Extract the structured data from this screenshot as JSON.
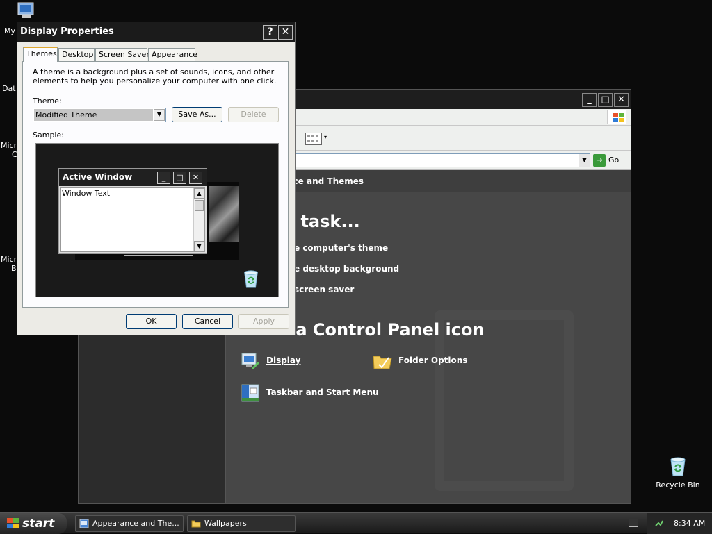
{
  "desktop": {
    "icons": [
      {
        "label": "My"
      },
      {
        "label": "Dat"
      },
      {
        "label": "Micro"
      },
      {
        "label": "C"
      },
      {
        "label": "Micr"
      },
      {
        "label": "B"
      }
    ],
    "recycle_bin": "Recycle Bin"
  },
  "control_panel": {
    "go_label": "Go",
    "header": "nce and Themes",
    "pick_task": "n task...",
    "tasks": [
      "e computer's theme",
      "e desktop background",
      "screen saver"
    ],
    "pick_icon": "k a Control Panel icon",
    "icons": [
      {
        "label": "Display"
      },
      {
        "label": "Folder Options"
      },
      {
        "label": "Taskbar and Start Menu"
      }
    ]
  },
  "dialog": {
    "title": "Display Properties",
    "help": "?",
    "close": "✕",
    "tabs": [
      "Themes",
      "Desktop",
      "Screen Saver",
      "Appearance"
    ],
    "description": "A theme is a background plus a set of sounds, icons, and other elements to help you personalize your computer with one click.",
    "theme_label": "Theme:",
    "theme_value": "Modified Theme",
    "save_as": "Save As...",
    "delete": "Delete",
    "sample_label": "Sample:",
    "preview": {
      "title": "Active Window",
      "text": "Window Text"
    },
    "ok": "OK",
    "cancel": "Cancel",
    "apply": "Apply"
  },
  "taskbar": {
    "start": "start",
    "tasks": [
      "Appearance and The...",
      "Wallpapers"
    ],
    "clock": "8:34 AM"
  },
  "colors": {
    "dialog_bg": "#ecebe6",
    "titlebar": "#1b1b1b",
    "control_panel_content": "#474747",
    "active_tab_accent": "#e0a82e"
  }
}
